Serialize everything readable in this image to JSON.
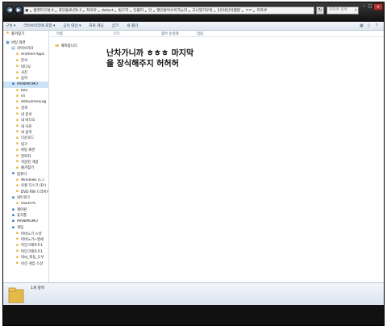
{
  "titlebar": {
    "breadcrumbs": [
      "컴퓨터구성 II",
      "포인들루션0.3",
      "자이아",
      "detect",
      "법구지",
      "인플러",
      "인",
      "명인방아쓰이가능미",
      "고니밀가우릭",
      "2인네신이템량",
      "ㅋㅋ",
      "카카쿠"
    ],
    "search_placeholder": "카카쿠 검색",
    "refresh": "↻",
    "back": "◀",
    "forward": "▶"
  },
  "toolbar": {
    "items": [
      "구성 ▾",
      "라이브러리에 포함 ▾",
      "공유 대상 ▾",
      "프로 제공",
      "굽기",
      "새 폴더"
    ]
  },
  "sidebar": {
    "items": [
      {
        "label": "즐겨찾기",
        "icon": "★",
        "level": 0
      },
      {
        "label": "",
        "icon": "",
        "level": -1
      },
      {
        "label": "바탕 화면",
        "icon": "▣",
        "level": 0
      },
      {
        "label": "라이브러리",
        "icon": "▤",
        "level": 1
      },
      {
        "label": "Android Apps",
        "icon": "▪",
        "level": 2
      },
      {
        "label": "문서",
        "icon": "▪",
        "level": 2
      },
      {
        "label": "비디오",
        "icon": "▪",
        "level": 2
      },
      {
        "label": "사진",
        "icon": "▪",
        "level": 2
      },
      {
        "label": "음악",
        "icon": "▪",
        "level": 2
      },
      {
        "label": "MANIMOMO",
        "icon": "▪",
        "level": 1
      },
      {
        "label": "bee",
        "icon": "▪",
        "level": 2
      },
      {
        "label": "ini",
        "icon": "▪",
        "level": 2
      },
      {
        "label": "AdsGamesLog",
        "icon": "▪",
        "level": 2
      },
      {
        "label": "검색",
        "icon": "▪",
        "level": 2
      },
      {
        "label": "내 문서",
        "icon": "▪",
        "level": 2
      },
      {
        "label": "내 비디오",
        "icon": "▪",
        "level": 2
      },
      {
        "label": "내 사진",
        "icon": "▪",
        "level": 2
      },
      {
        "label": "내 음악",
        "icon": "▪",
        "level": 2
      },
      {
        "label": "다운로드",
        "icon": "▪",
        "level": 2
      },
      {
        "label": "링크",
        "icon": "▪",
        "level": 2
      },
      {
        "label": "바탕 화면",
        "icon": "▪",
        "level": 2
      },
      {
        "label": "연락처",
        "icon": "▪",
        "level": 2
      },
      {
        "label": "저장된 게임",
        "icon": "▪",
        "level": 2
      },
      {
        "label": "즐겨찾기",
        "icon": "▪",
        "level": 2
      },
      {
        "label": "컴퓨터",
        "icon": "▪",
        "level": 1
      },
      {
        "label": "Windows (C:)",
        "icon": "▪",
        "level": 2
      },
      {
        "label": "로컬 디스크 (D:)",
        "icon": "▪",
        "level": 2
      },
      {
        "label": "DVD RW 드라이브",
        "icon": "▪",
        "level": 2
      },
      {
        "label": "네트워크",
        "icon": "▪",
        "level": 1
      },
      {
        "label": "USER-PC",
        "icon": "▪",
        "level": 2
      },
      {
        "label": "제어판",
        "icon": "▪",
        "level": 1
      },
      {
        "label": "휴지통",
        "icon": "▪",
        "level": 1
      },
      {
        "label": "MANIMOMO",
        "icon": "▪",
        "level": 1
      },
      {
        "label": "게임",
        "icon": "▪",
        "level": 1
      },
      {
        "label": "마비노기 스샷",
        "icon": "▪",
        "level": 2
      },
      {
        "label": "마비노기+영세",
        "icon": "▪",
        "level": 2
      },
      {
        "label": "마인크래프트1",
        "icon": "▪",
        "level": 2
      },
      {
        "label": "마인크래프트1",
        "icon": "▪",
        "level": 2
      },
      {
        "label": "외씨_폭동_도우",
        "icon": "▪",
        "level": 2
      },
      {
        "label": "이건 게임 스샷",
        "icon": "▪",
        "level": 2
      }
    ]
  },
  "columns": [
    "이름",
    "크기",
    "찾아 순의에",
    "업림"
  ],
  "files": [
    {
      "name": "폐하합니다"
    }
  ],
  "annotation_text": "난차가니까 ㅎㅎㅎ 마지막\n을 장식해주지 허허허",
  "status": {
    "text": "1개 항목"
  },
  "colors": {
    "titlebar": "#1b1b1b",
    "toolbar": "#e6edf5",
    "folder": "#e4b94a",
    "selection": "#cce3f7"
  }
}
